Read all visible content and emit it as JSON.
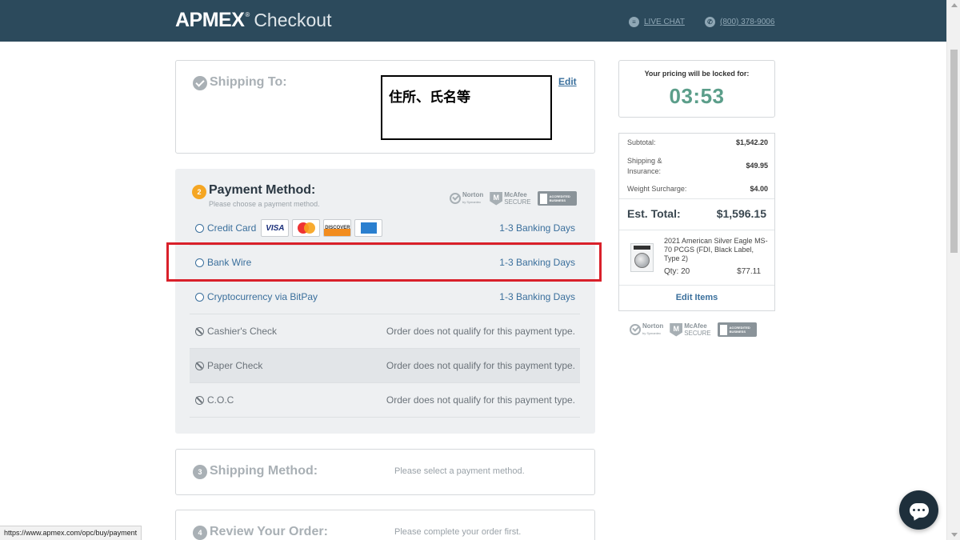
{
  "header": {
    "brand": "APMEX",
    "brand_reg": "®",
    "section": "Checkout",
    "live_chat": "LIVE CHAT",
    "phone": "(800) 378-9006",
    "background_color": "#2c4a5c"
  },
  "shipping_to": {
    "title": "Shipping To:",
    "address_placeholder": "住所、氏名等",
    "edit_label": "Edit"
  },
  "payment": {
    "step": "2",
    "title": "Payment Method:",
    "subtitle": "Please choose a payment method.",
    "trust": {
      "norton": "Norton",
      "norton_sub": "by Symantec",
      "mcafee_line1": "McAfee",
      "mcafee_line2": "SECURE",
      "bbb_line1": "ACCREDITED",
      "bbb_line2": "BUSINESS"
    },
    "options": [
      {
        "label": "Credit Card",
        "detail": "1-3 Banking Days",
        "available": true
      },
      {
        "label": "Bank Wire",
        "detail": "1-3 Banking Days",
        "available": true
      },
      {
        "label": "Cryptocurrency via BitPay",
        "detail": "1-3 Banking Days",
        "available": true
      },
      {
        "label": "Cashier's Check",
        "detail": "Order does not qualify for this payment type.",
        "available": false
      },
      {
        "label": "Paper Check",
        "detail": "Order does not qualify for this payment type.",
        "available": false
      },
      {
        "label": "C.O.C",
        "detail": "Order does not qualify for this payment type.",
        "available": false
      }
    ],
    "card_brands": {
      "visa": "VISA",
      "mastercard": "mastercard-icon",
      "discover": "DISCOVER",
      "amex": "amex-icon"
    },
    "highlight_color": "#d9202a"
  },
  "shipping_method": {
    "step": "3",
    "title": "Shipping Method:",
    "note": "Please select a payment method."
  },
  "review": {
    "step": "4",
    "title": "Review Your Order:",
    "note": "Please complete your order first."
  },
  "timer": {
    "label": "Your pricing will be locked for:",
    "value": "03:53"
  },
  "summary": {
    "subtotal_label": "Subtotal:",
    "subtotal_value": "$1,542.20",
    "shipping_label_1": "Shipping &",
    "shipping_label_2": "Insurance:",
    "shipping_value": "$49.95",
    "weight_label": "Weight Surcharge:",
    "weight_value": "$4.00",
    "est_label": "Est. Total:",
    "est_value": "$1,596.15",
    "item": {
      "name": "2021 American Silver Eagle MS-70 PCGS (FDI, Black Label, Type 2)",
      "qty": "Qty: 20",
      "price": "$77.11"
    },
    "edit_items": "Edit Items"
  },
  "statusbar": {
    "url": "https://www.apmex.com/opc/buy/payment"
  }
}
